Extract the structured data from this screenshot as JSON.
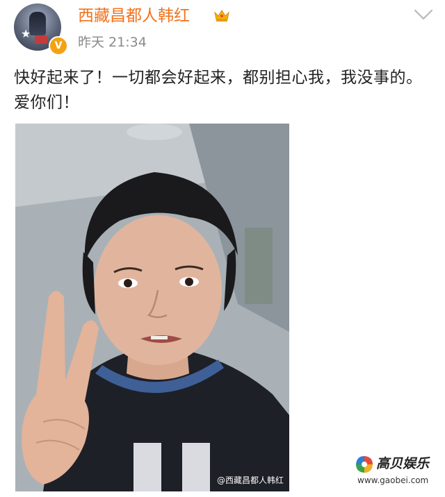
{
  "post": {
    "username": "西藏昌都人韩红",
    "time": "昨天 21:34",
    "text": "快好起来了！一切都会好起来，都别担心我，我没事的。爱你们！",
    "avatar_icon": "user-avatar",
    "verified_icon": "verified-badge-icon",
    "verified_letter": "V",
    "member_icon": "crown-icon",
    "menu_icon": "chevron-down-icon"
  },
  "photo": {
    "watermark": "@西藏昌都人韩红"
  },
  "site": {
    "name": "高贝娱乐",
    "url": "www.gaobei.com"
  },
  "colors": {
    "username": "#f2721c",
    "time": "#8a8a8a",
    "text": "#222222",
    "verified": "#f3a312"
  }
}
